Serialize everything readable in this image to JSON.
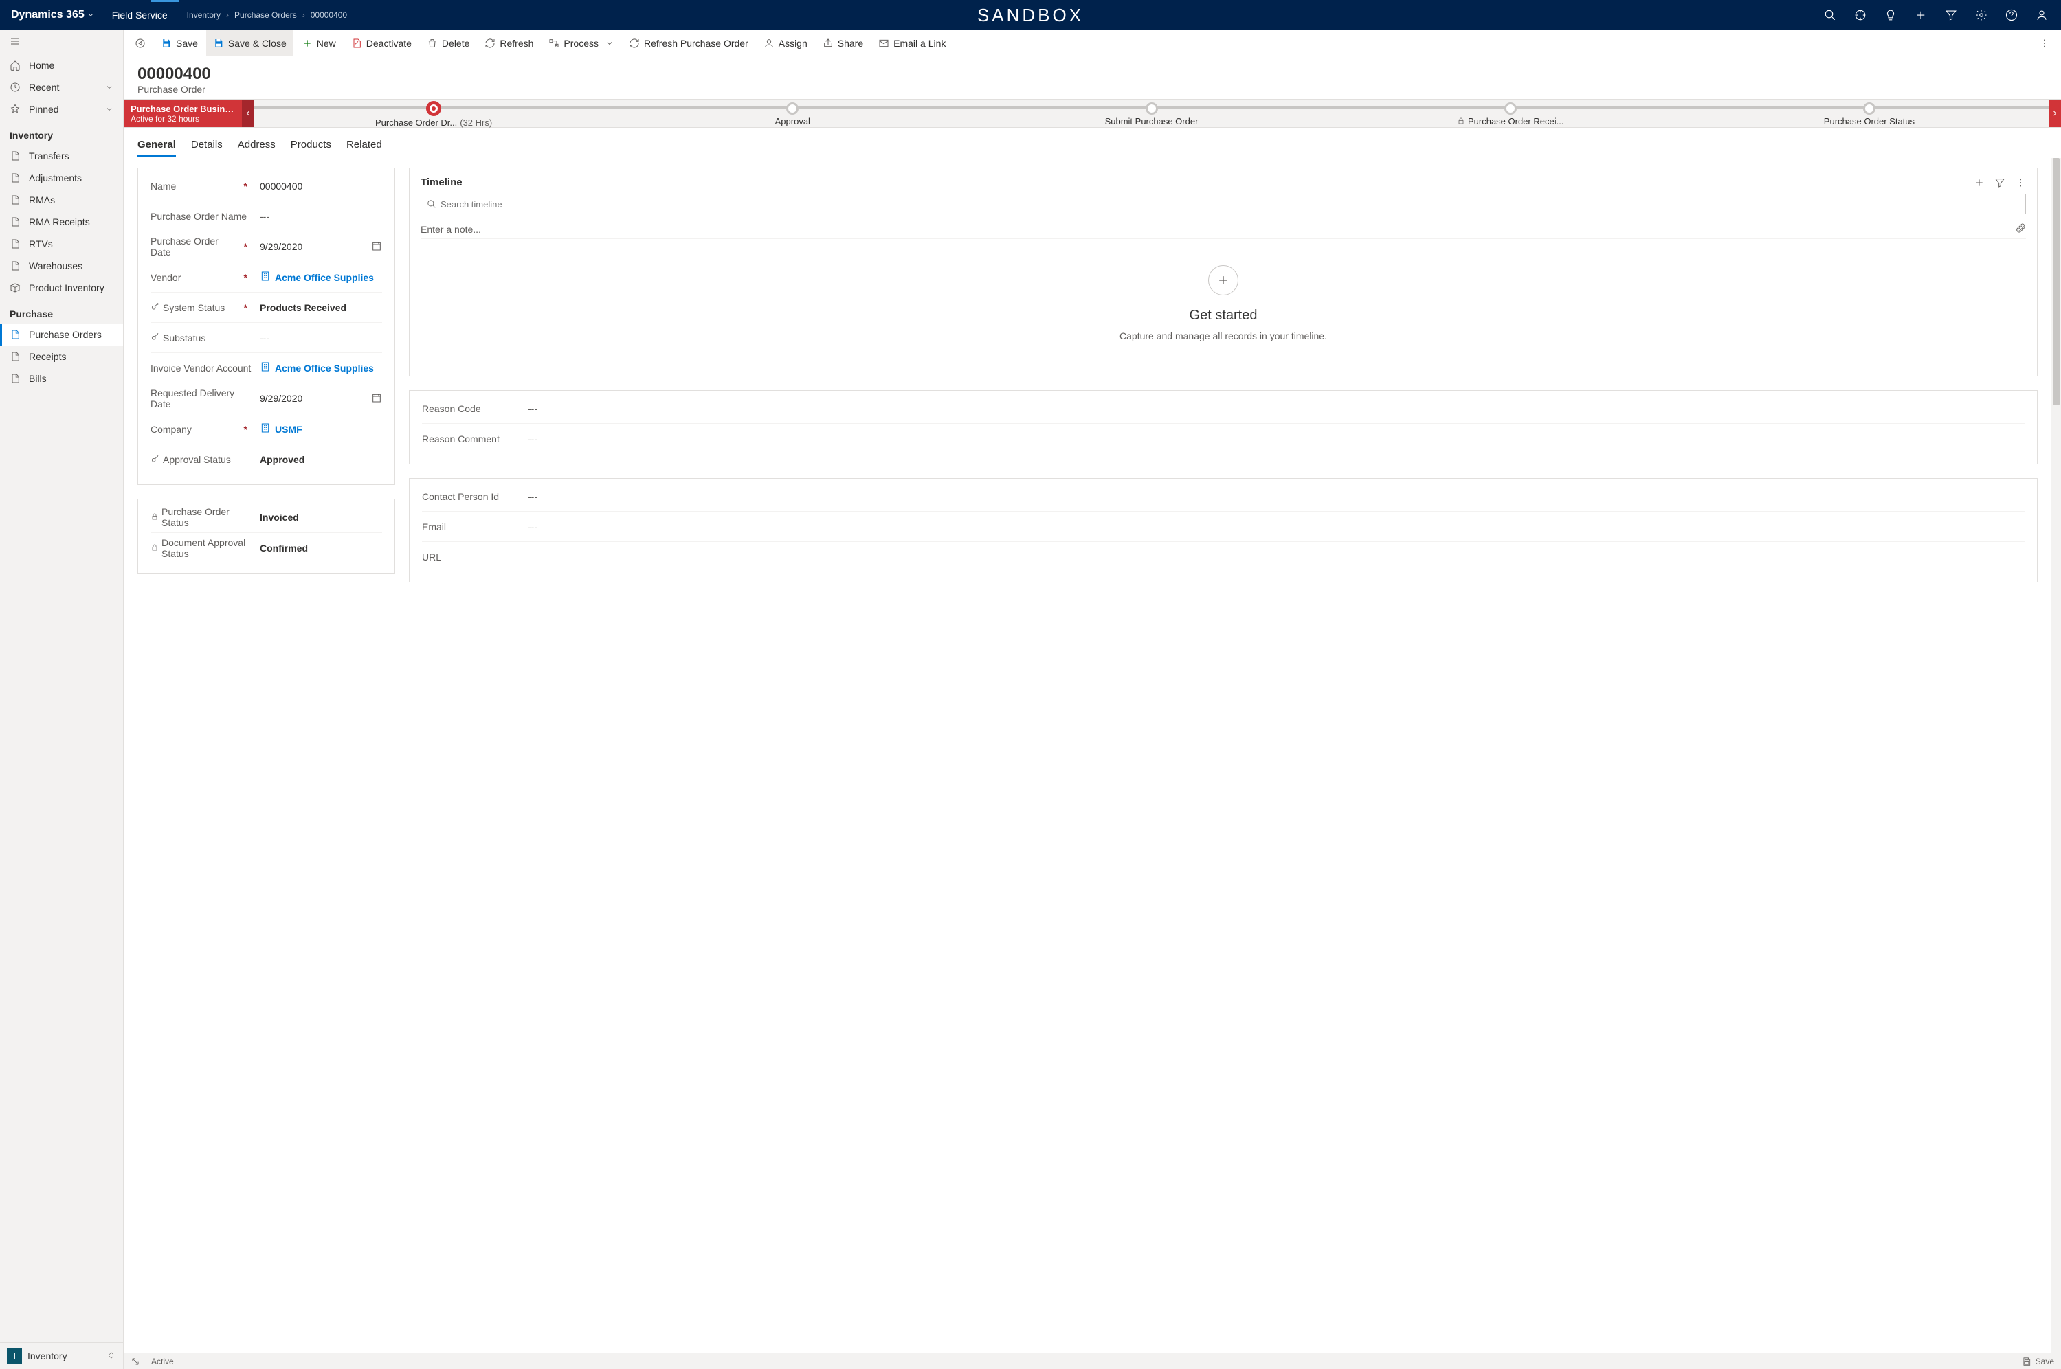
{
  "topbar": {
    "app": "Dynamics 365",
    "module": "Field Service",
    "breadcrumbs": [
      "Inventory",
      "Purchase Orders",
      "00000400"
    ],
    "center": "SANDBOX"
  },
  "sidebar": {
    "home": "Home",
    "recent": "Recent",
    "pinned": "Pinned",
    "group_inventory": "Inventory",
    "inv_items": {
      "transfers": "Transfers",
      "adjustments": "Adjustments",
      "rmas": "RMAs",
      "rma_receipts": "RMA Receipts",
      "rtvs": "RTVs",
      "warehouses": "Warehouses",
      "product_inventory": "Product Inventory"
    },
    "group_purchase": "Purchase",
    "pur_items": {
      "purchase_orders": "Purchase Orders",
      "receipts": "Receipts",
      "bills": "Bills"
    },
    "area_badge": "I",
    "area_name": "Inventory"
  },
  "cmdbar": {
    "save": "Save",
    "save_close": "Save & Close",
    "new": "New",
    "deactivate": "Deactivate",
    "delete": "Delete",
    "refresh": "Refresh",
    "process": "Process",
    "refresh_po": "Refresh Purchase Order",
    "assign": "Assign",
    "share": "Share",
    "email": "Email a Link"
  },
  "header": {
    "title": "00000400",
    "subtitle": "Purchase Order"
  },
  "bpf": {
    "title": "Purchase Order Business ...",
    "sub": "Active for 32 hours",
    "stages": [
      {
        "name": "Purchase Order Dr...",
        "time": "(32 Hrs)",
        "active": true
      },
      {
        "name": "Approval"
      },
      {
        "name": "Submit Purchase Order"
      },
      {
        "name": "Purchase Order Recei...",
        "locked": true
      },
      {
        "name": "Purchase Order Status"
      }
    ]
  },
  "tabs": [
    "General",
    "Details",
    "Address",
    "Products",
    "Related"
  ],
  "form": {
    "name_label": "Name",
    "name_value": "00000400",
    "po_name_label": "Purchase Order Name",
    "po_name_value": "---",
    "po_date_label": "Purchase Order Date",
    "po_date_value": "9/29/2020",
    "vendor_label": "Vendor",
    "vendor_value": "Acme Office Supplies",
    "system_status_label": "System Status",
    "system_status_value": "Products Received",
    "substatus_label": "Substatus",
    "substatus_value": "---",
    "invoice_vendor_label": "Invoice Vendor Account",
    "invoice_vendor_value": "Acme Office Supplies",
    "req_delivery_label": "Requested Delivery Date",
    "req_delivery_value": "9/29/2020",
    "company_label": "Company",
    "company_value": "USMF",
    "approval_status_label": "Approval Status",
    "approval_status_value": "Approved",
    "po_status_label": "Purchase Order Status",
    "po_status_value": "Invoiced",
    "doc_approval_label": "Document Approval Status",
    "doc_approval_value": "Confirmed"
  },
  "timeline": {
    "title": "Timeline",
    "search_placeholder": "Search timeline",
    "note_placeholder": "Enter a note...",
    "empty_title": "Get started",
    "empty_msg": "Capture and manage all records in your timeline."
  },
  "reason_card": {
    "code_label": "Reason Code",
    "code_value": "---",
    "comment_label": "Reason Comment",
    "comment_value": "---"
  },
  "contact_card": {
    "contact_label": "Contact Person Id",
    "contact_value": "---",
    "email_label": "Email",
    "email_value": "---",
    "url_label": "URL",
    "url_value": ""
  },
  "statusbar": {
    "status": "Active",
    "save": "Save"
  }
}
